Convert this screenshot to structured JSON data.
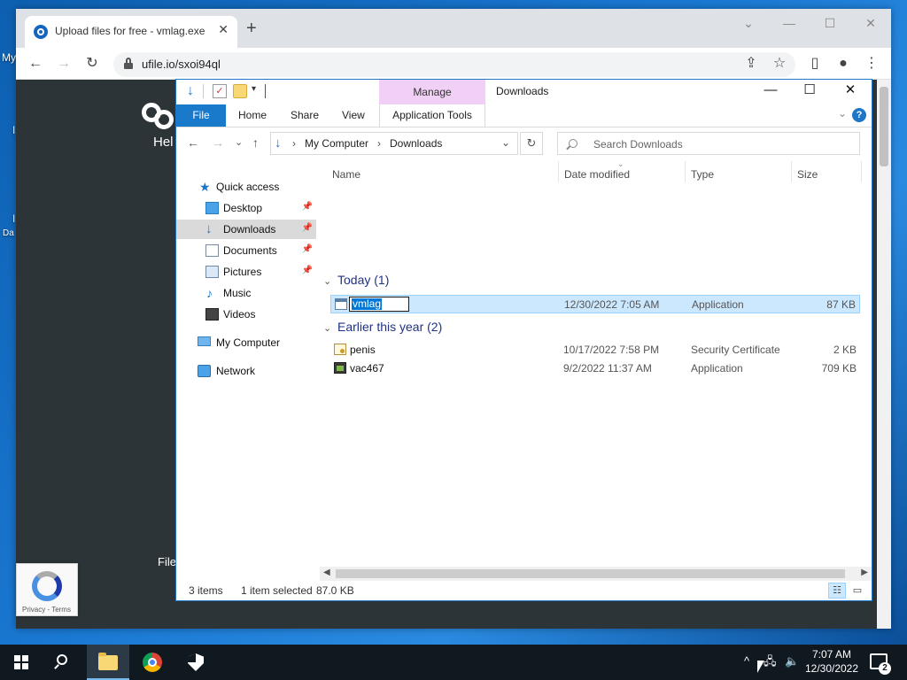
{
  "desktop": {
    "icon_labels": [
      "My",
      "I",
      "Da"
    ]
  },
  "browser": {
    "tab_title": "Upload files for free - vmlag.exe",
    "tab_close": "✕",
    "new_tab": "+",
    "window_controls": {
      "minimize": "—",
      "maximize": "☐",
      "close": "✕",
      "chevron": "⌄"
    },
    "url": "ufile.io/sxoi94ql",
    "nav": {
      "back": "←",
      "forward": "→",
      "reload": "↻"
    },
    "actions": {
      "share": "⇪",
      "bookmark": "☆",
      "sidepanel": "▯",
      "profile": "●",
      "menu": "⋮"
    }
  },
  "page": {
    "heading_partial": "Hel",
    "files_partial": "File",
    "recaptcha_links": "Privacy - Terms"
  },
  "explorer": {
    "title": "Downloads",
    "contextual_group": "Manage",
    "ribbon_tabs": {
      "file": "File",
      "home": "Home",
      "share": "Share",
      "view": "View",
      "application_tools": "Application Tools"
    },
    "help": "?",
    "ribbon_chevron": "⌄",
    "window_controls": {
      "minimize": "—",
      "maximize": "☐",
      "close": "✕"
    },
    "nav_buttons": {
      "back": "←",
      "forward": "→",
      "recent": "⌄",
      "up": "↑"
    },
    "address": {
      "separator": "›",
      "segments": [
        "My Computer",
        "Downloads"
      ],
      "dropdown": "⌄",
      "refresh": "↻"
    },
    "search_placeholder": "Search Downloads",
    "nav_pane": [
      {
        "label": "Quick access",
        "icon": "star-icon",
        "pinned": false
      },
      {
        "label": "Desktop",
        "icon": "desktop-icon",
        "pinned": true
      },
      {
        "label": "Downloads",
        "icon": "download-icon",
        "pinned": true,
        "selected": true
      },
      {
        "label": "Documents",
        "icon": "documents-icon",
        "pinned": true
      },
      {
        "label": "Pictures",
        "icon": "pictures-icon",
        "pinned": true
      },
      {
        "label": "Music",
        "icon": "music-icon",
        "pinned": false
      },
      {
        "label": "Videos",
        "icon": "videos-icon",
        "pinned": false
      },
      {
        "label": "My Computer",
        "icon": "computer-icon",
        "pinned": false
      },
      {
        "label": "Network",
        "icon": "network-icon",
        "pinned": false
      }
    ],
    "pin_glyph": "📌",
    "columns": {
      "name": "Name",
      "date": "Date modified",
      "type": "Type",
      "size": "Size"
    },
    "groups": [
      {
        "label": "Today (1)",
        "files": [
          {
            "name": "vmlag",
            "date": "12/30/2022 7:05 AM",
            "type": "Application",
            "size": "87 KB",
            "icon": "application-icon",
            "selected": true,
            "renaming": true
          }
        ]
      },
      {
        "label": "Earlier this year (2)",
        "files": [
          {
            "name": "penis",
            "date": "10/17/2022 7:58 PM",
            "type": "Security Certificate",
            "size": "2 KB",
            "icon": "certificate-icon"
          },
          {
            "name": "vac467",
            "date": "9/2/2022 11:37 AM",
            "type": "Application",
            "size": "709 KB",
            "icon": "vac-app-icon"
          }
        ]
      }
    ],
    "group_chevron": "⌄",
    "status": {
      "items": "3 items",
      "selected": "1 item selected",
      "size": "87.0 KB"
    },
    "view_buttons": {
      "details": "☷",
      "large_icons": "▭"
    }
  },
  "taskbar": {
    "clock_time": "7:07 AM",
    "clock_date": "12/30/2022",
    "tray": {
      "chevron": "^",
      "network": "🖧",
      "volume": "🔈"
    },
    "notification_count": "2"
  },
  "colors": {
    "accent": "#1979ca",
    "selection": "#cce8ff",
    "manage_tab": "#f0d0f5",
    "taskbar": "#101820"
  }
}
